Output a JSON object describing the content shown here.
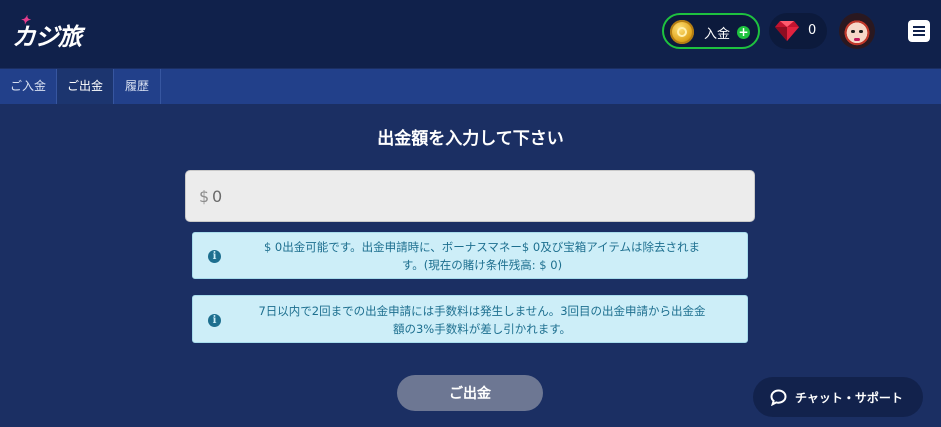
{
  "header": {
    "logo_text": "カジ旅",
    "deposit_label": "入金",
    "plus_label": "+",
    "gem_count": "0"
  },
  "tabs": [
    {
      "label": "ご入金"
    },
    {
      "label": "ご出金",
      "active": true
    },
    {
      "label": "履歴"
    }
  ],
  "main": {
    "title": "出金額を入力して下さい",
    "amount_currency": "$",
    "amount_value": "0",
    "info_icon": "i",
    "notices": [
      {
        "line1": "$ 0出金可能です。出金申請時に、ボーナスマネー$ 0及び宝箱アイテムは除去されま",
        "line2": "す。(現在の賭け条件残高: $ 0)"
      },
      {
        "line1": "7日以内で2回までの出金申請には手数料は発生しません。3回目の出金申請から出金金",
        "line2": "額の3%手数料が差し引かれます。"
      }
    ],
    "withdraw_button": "ご出金"
  },
  "chat": {
    "label": "チャット・サポート"
  },
  "colors": {
    "header_bg": "#10214b",
    "page_bg": "#1b2f63",
    "tab_bg": "#22408a",
    "accent_green": "#1ec23f",
    "info_bg": "#cdeef8",
    "info_text": "#1d6f8f",
    "button_disabled": "#6d7793"
  },
  "icons": [
    "coin-icon",
    "plus-icon",
    "gem-icon",
    "avatar",
    "hamburger-menu-icon",
    "info-icon",
    "chat-bubble-icon"
  ]
}
